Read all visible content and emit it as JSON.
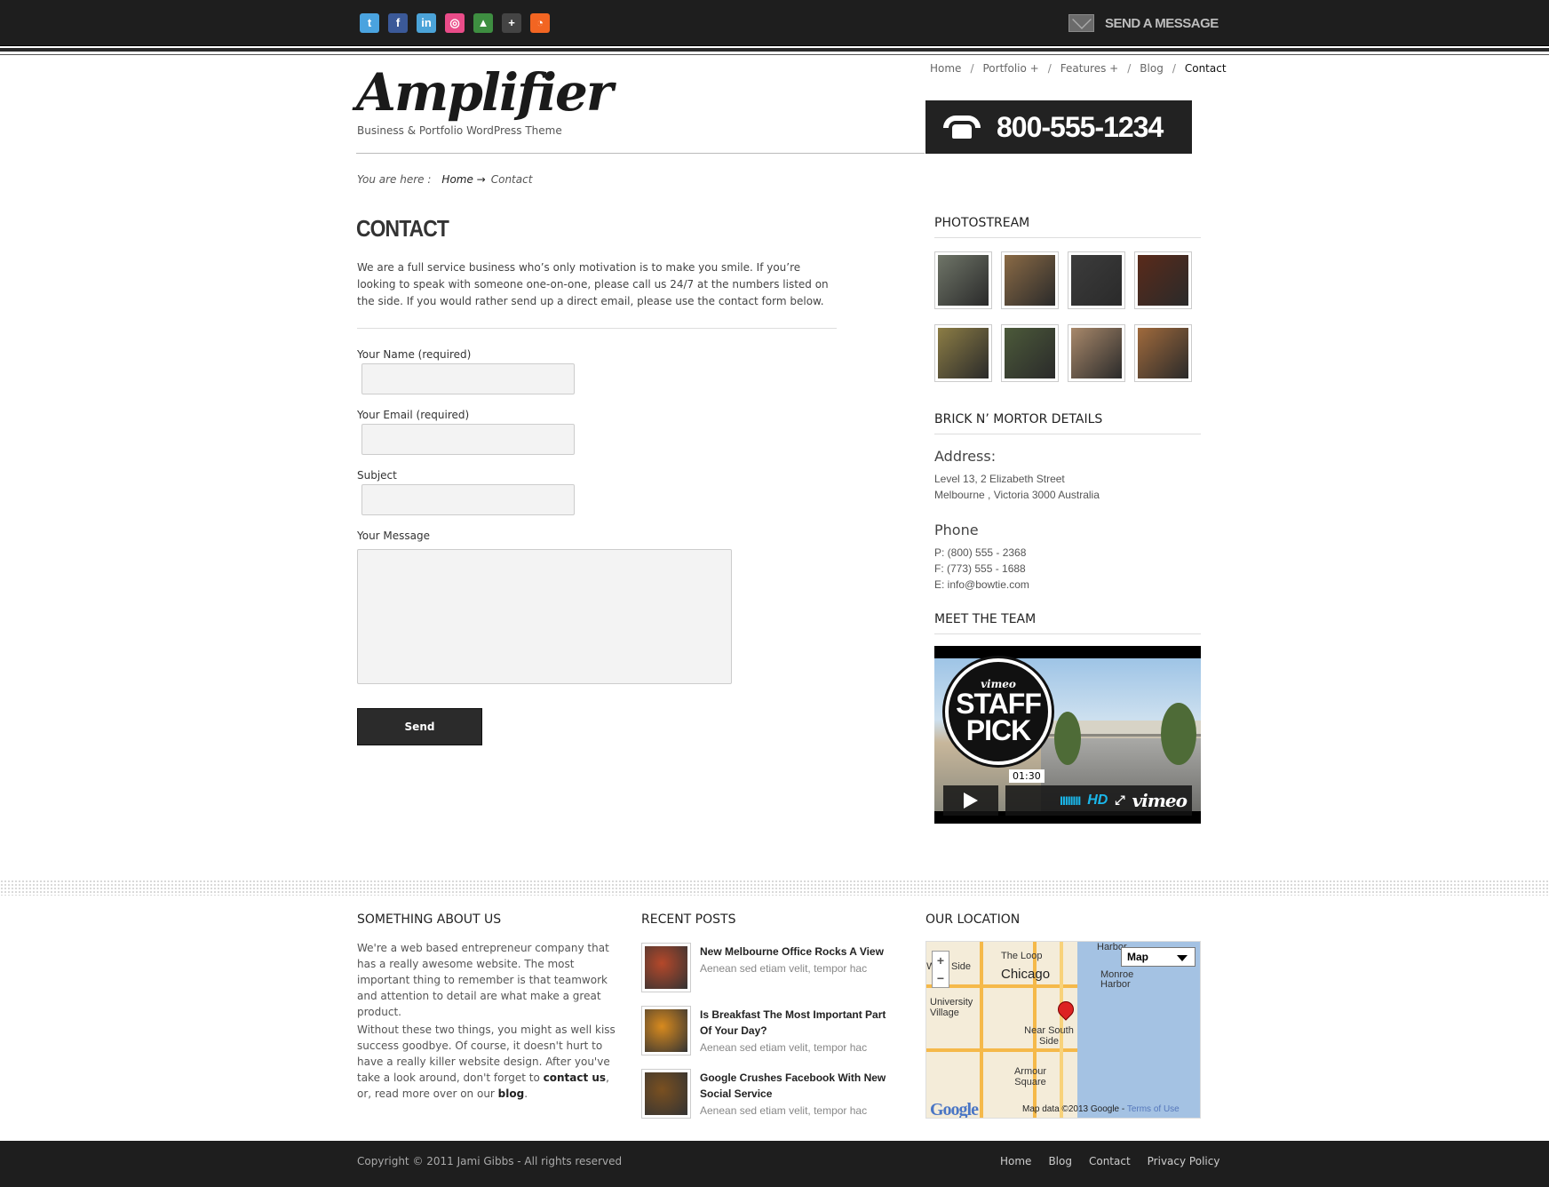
{
  "topbar": {
    "social_icons": [
      {
        "name": "twitter-icon",
        "glyph": "t",
        "color": "#4aa3df"
      },
      {
        "name": "facebook-icon",
        "glyph": "f",
        "color": "#3b5998"
      },
      {
        "name": "linkedin-icon",
        "glyph": "in",
        "color": "#4ba3d8"
      },
      {
        "name": "dribbble-icon",
        "glyph": "◎",
        "color": "#ea4c89"
      },
      {
        "name": "forrst-icon",
        "glyph": "▲",
        "color": "#3e8e41"
      },
      {
        "name": "google-plus-icon",
        "glyph": "+",
        "color": "#444444"
      },
      {
        "name": "rss-icon",
        "glyph": "◔",
        "color": "#f26522"
      }
    ],
    "send_message": "SEND A MESSAGE"
  },
  "header": {
    "logo": "Amplifier",
    "tagline": "Business & Portfolio WordPress Theme",
    "nav": [
      "Home",
      "Portfolio +",
      "Features +",
      "Blog",
      "Contact"
    ],
    "phone": "800-555-1234"
  },
  "breadcrumb": {
    "prefix": "You are here :",
    "home": "Home →",
    "current": "Contact"
  },
  "main": {
    "title": "CONTACT",
    "intro": "We are a full service business who’s only motivation is to make you smile.  If you’re looking to speak with someone one-on-one, please call us 24/7 at the numbers listed on the side.  If you would rather send up a direct email, please use the contact form below.",
    "form": {
      "name_label": "Your Name (required)",
      "email_label": "Your Email (required)",
      "subject_label": "Subject",
      "message_label": "Your Message",
      "send": "Send"
    }
  },
  "sidebar": {
    "photostream_title": "PHOTOSTREAM",
    "photos": [
      {
        "name": "photo-hand",
        "color": "#6f7568"
      },
      {
        "name": "photo-dog-fence",
        "color": "#8a6a45"
      },
      {
        "name": "photo-jeans",
        "color": "#3c3c3c"
      },
      {
        "name": "photo-lanterns",
        "color": "#5a2a1a"
      },
      {
        "name": "photo-bicycle",
        "color": "#8c7d45"
      },
      {
        "name": "photo-herbs",
        "color": "#4c5a3a"
      },
      {
        "name": "photo-puppy",
        "color": "#a8886a"
      },
      {
        "name": "photo-chihuahua",
        "color": "#a06a3c"
      }
    ],
    "details_title": "BRICK N’ MORTOR DETAILS",
    "address_head": "Address:",
    "address_lines": [
      "Level 13, 2 Elizabeth Street",
      "Melbourne , Victoria 3000 Australia"
    ],
    "phone_head": "Phone",
    "phone_lines": [
      "P: (800) 555 - 2368",
      "F: (773) 555 - 1688",
      "E: info@bowtie.com"
    ],
    "team_title": "MEET THE TEAM",
    "video": {
      "badge_top": "vimeo",
      "badge_main": "STAFF PICK",
      "time": "01:30",
      "volume": "IIIIIIII",
      "hd": "HD",
      "logo": "vimeo"
    }
  },
  "footer": {
    "about_title": "SOMETHING ABOUT US",
    "about_p1": "We're a web based entrepreneur company that has a really awesome website. The most important thing to remember is that teamwork and attention to detail are what make a great product.",
    "about_p2_start": "Without these two things, you might as well kiss success goodbye. Of course, it doesn't hurt to have a really killer website design. After you've take a look around, don't forget to ",
    "about_link1": "contact us",
    "about_p2_mid": ", or, read more over on our ",
    "about_link2": "blog",
    "about_p2_end": ".",
    "posts_title": "RECENT POSTS",
    "posts": [
      {
        "title": "New Melbourne Office Rocks A View",
        "excerpt": "Aenean sed etiam velit, tempor hac",
        "color": "#b5482a"
      },
      {
        "title": "Is Breakfast The Most Important Part Of Your Day?",
        "excerpt": "Aenean sed etiam velit, tempor hac",
        "color": "#d88a1e"
      },
      {
        "title": "Google Crushes Facebook With New Social Service",
        "excerpt": "Aenean sed etiam velit, tempor hac",
        "color": "#7a5020"
      }
    ],
    "location_title": "OUR LOCATION",
    "map": {
      "select": "Map",
      "labels": [
        "Harbor",
        "The Loop",
        "Chicago",
        "Monroe Harbor",
        "University Village",
        "Near South Side",
        "Armour Square",
        "West Side"
      ],
      "credit": "Map data ©2013 Google - ",
      "terms": "Terms of Use",
      "google": "Google"
    },
    "copyright": "Copyright © 2011 Jami Gibbs - All rights reserved",
    "nav": [
      "Home",
      "Blog",
      "Contact",
      "Privacy Policy"
    ]
  }
}
